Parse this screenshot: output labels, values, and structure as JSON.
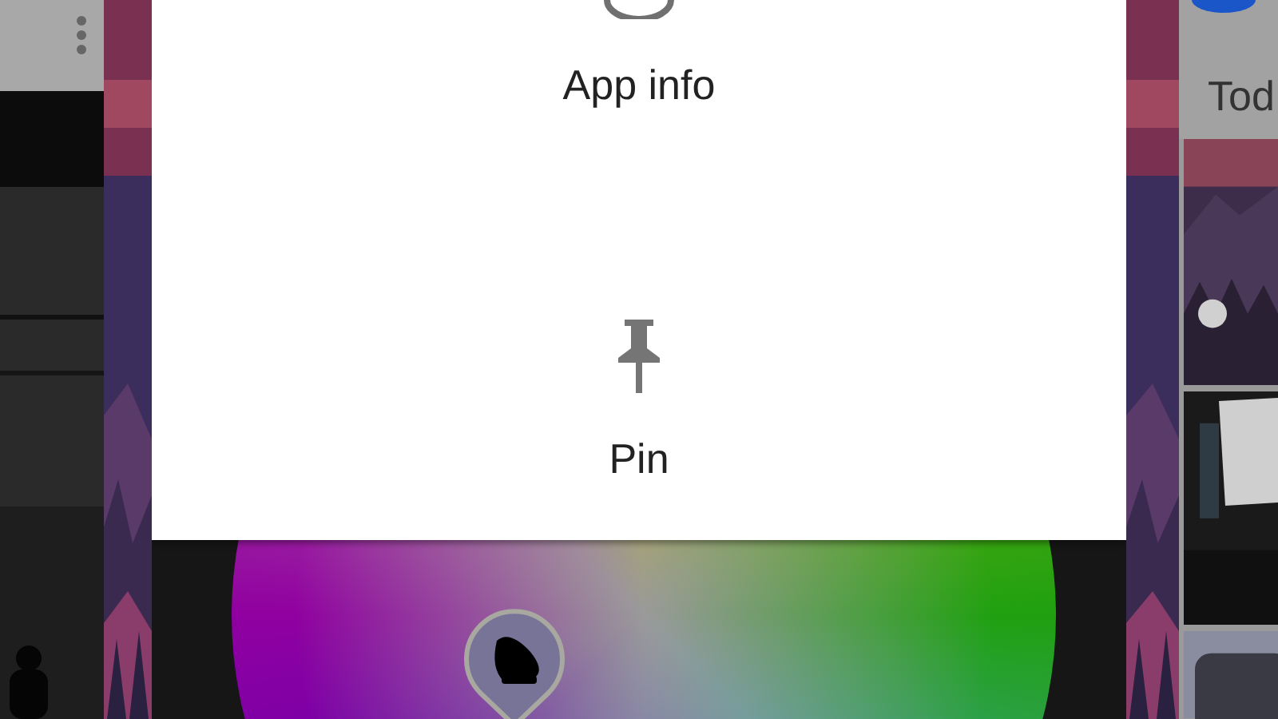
{
  "menu": {
    "items": [
      {
        "kind": "info",
        "label": "App info"
      },
      {
        "kind": "pin",
        "label": "Pin"
      }
    ]
  },
  "right_card": {
    "title": "Tod"
  }
}
